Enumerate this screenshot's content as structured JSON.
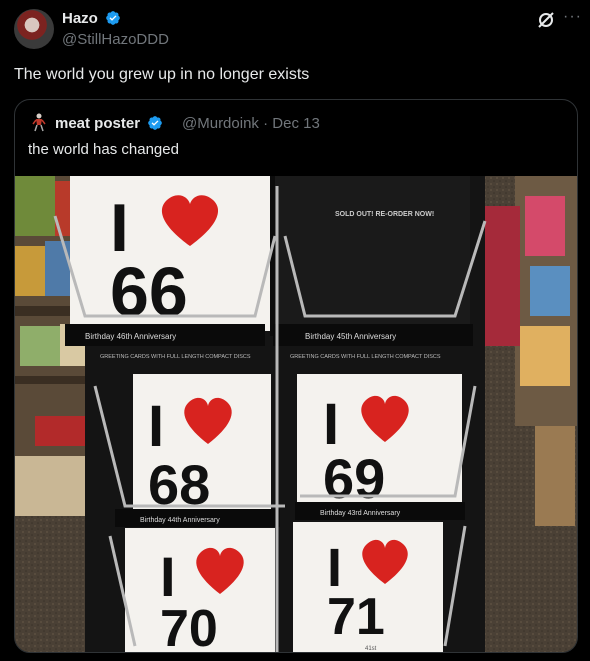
{
  "post": {
    "author_name": "Hazo",
    "author_handle": "@StillHazoDDD",
    "text": "The world you grew up in no longer exists"
  },
  "quoted": {
    "author_name": "meat poster",
    "author_handle": "@Murdoink",
    "separator": "·",
    "date": "Dec 13",
    "text": "the world has changed"
  },
  "photo": {
    "cards": [
      {
        "heart": "I",
        "number": "66",
        "caption": "Birthday 46th Anniversary"
      },
      {
        "number": "",
        "caption": "Birthday 45th Anniversary",
        "sign": "SOLD OUT! RE-ORDER NOW!"
      },
      {
        "heart": "I",
        "number": "68",
        "caption": "Birthday 44th Anniversary"
      },
      {
        "heart": "I",
        "number": "69",
        "caption": "Birthday 43rd Anniversary"
      },
      {
        "heart": "I",
        "number": "70",
        "caption": ""
      },
      {
        "heart": "I",
        "number": "71",
        "caption": "41st"
      }
    ],
    "strip_text": "GREETING CARDS WITH FULL LENGTH COMPACT DISCS"
  },
  "colors": {
    "verified": "#1d9bf0",
    "heart": "#d8231f",
    "muted": "#71767b"
  }
}
